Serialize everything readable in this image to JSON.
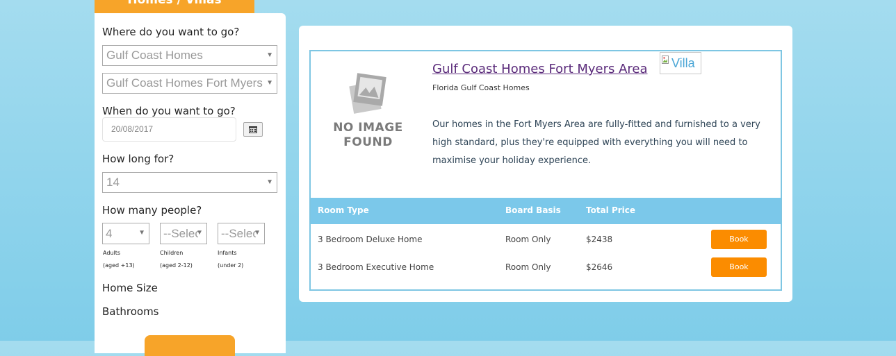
{
  "header_tab": {
    "label": "Homes / Villas"
  },
  "search": {
    "where_label": "Where do you want to go?",
    "region": "Gulf Coast Homes",
    "area": "Gulf Coast Homes Fort Myers Area",
    "when_label": "When do you want to go?",
    "date": "20/08/2017",
    "how_long_label": "How long for?",
    "nights": "14",
    "people_label": "How many people?",
    "adults": "4",
    "children": "--Select--",
    "infants": "--Select--",
    "adults_label": "Adults",
    "adults_note": "(aged +13)",
    "children_label": "Children",
    "children_note": "(aged 2-12)",
    "infants_label": "Infants",
    "infants_note": "(under 2)",
    "home_size_label": "Home Size",
    "bathrooms_label": "Bathrooms"
  },
  "result": {
    "no_image_line1": "NO IMAGE",
    "no_image_line2": "FOUND",
    "title": "Gulf Coast Homes Fort Myers Area",
    "badge_alt": "Villa",
    "subtitle": "Florida Gulf Coast Homes",
    "description": "Our homes in the Fort Myers Area are fully-fitted and furnished to a very high standard, plus they're equipped with everything you will need to maximise your holiday experience.",
    "columns": {
      "room_type": "Room Type",
      "board_basis": "Board Basis",
      "total_price": "Total Price"
    },
    "rows": [
      {
        "room": "3 Bedroom Deluxe Home",
        "board": "Room Only",
        "price": "$2438",
        "book": "Book"
      },
      {
        "room": "3 Bedroom Executive Home",
        "board": "Room Only",
        "price": "$2646",
        "book": "Book"
      }
    ]
  },
  "colors": {
    "accent_orange": "#f7a429",
    "book_orange": "#fb8c00",
    "table_header_blue": "#7bc8ea",
    "title_purple": "#5a2a7a"
  }
}
